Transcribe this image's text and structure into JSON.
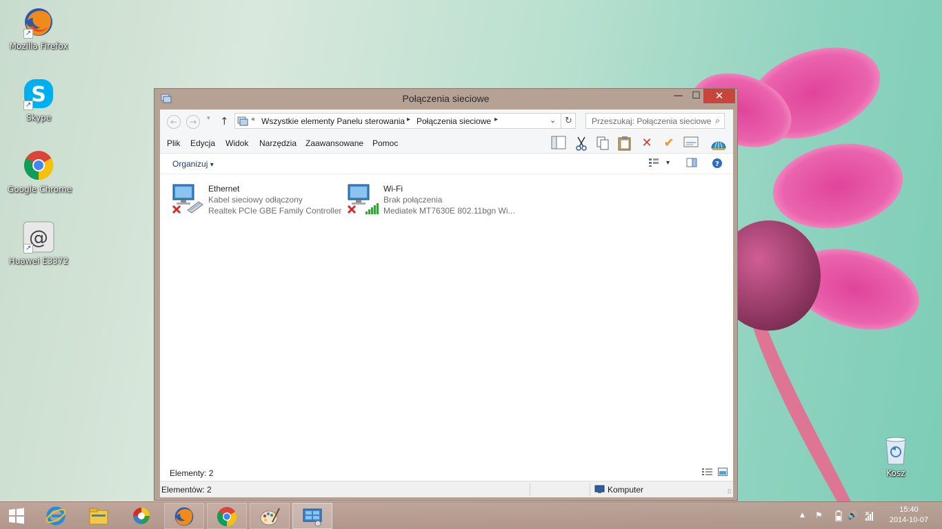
{
  "desktop": {
    "icons": [
      {
        "label": "Mozilla Firefox",
        "icon": "firefox-icon"
      },
      {
        "label": "Skype",
        "icon": "skype-icon"
      },
      {
        "label": "Google Chrome",
        "icon": "chrome-icon"
      },
      {
        "label": "Huawei E3372",
        "icon": "at-sign-icon",
        "glyph": "@"
      },
      {
        "label": "Kosz",
        "icon": "recycle-bin-icon"
      }
    ]
  },
  "window": {
    "title": "Połączenia sieciowe",
    "controls": {
      "minimize": "—",
      "maximize": "☐",
      "close": "✕"
    },
    "nav": {
      "back": "←",
      "forward": "→",
      "recent": "▾",
      "up": "↑",
      "address_prefix": "«",
      "breadcrumbs": [
        "Wszystkie elementy Panelu sterowania",
        "Połączenia sieciowe"
      ],
      "separator": "▸",
      "dropdown": "⌄",
      "refresh": "↻",
      "search_placeholder": "Przeszukaj: Połączenia sieciowe",
      "search_glyph": "⌕"
    },
    "menu": [
      "Plik",
      "Edycja",
      "Widok",
      "Narzędzia",
      "Zaawansowane",
      "Pomoc"
    ],
    "toolbar_icons": [
      "layout-icon",
      "cut-icon",
      "copy-icon",
      "paste-icon",
      "delete-icon",
      "check-icon",
      "properties-icon",
      "shell-icon"
    ],
    "command_bar": {
      "organize": "Organizuj",
      "organize_arrow": "▾",
      "view_arrow": "▾",
      "help": "?"
    },
    "connections": [
      {
        "name": "Ethernet",
        "status": "Kabel sieciowy odłączony",
        "device": "Realtek PCIe GBE Family Controller"
      },
      {
        "name": "Wi-Fi",
        "status": "Brak połączenia",
        "device": "Mediatek MT7630E 802.11bgn Wi..."
      }
    ],
    "detail": {
      "count_label": "Elementy: 2"
    },
    "status": {
      "items_label": "Elementów: 2",
      "zone_label": "Komputer",
      "grip": "⠿"
    }
  },
  "taskbar": {
    "start": "start-icon",
    "pinned": [
      "internet-explorer-icon",
      "file-explorer-icon",
      "picasa-icon",
      "firefox-icon",
      "chrome-icon",
      "paint-icon",
      "control-panel-icon"
    ],
    "tray": {
      "show_hidden": "▲",
      "flag": "⚑",
      "volume": "🔊"
    },
    "clock": {
      "time": "15:40",
      "date": "2014-10-07"
    }
  }
}
